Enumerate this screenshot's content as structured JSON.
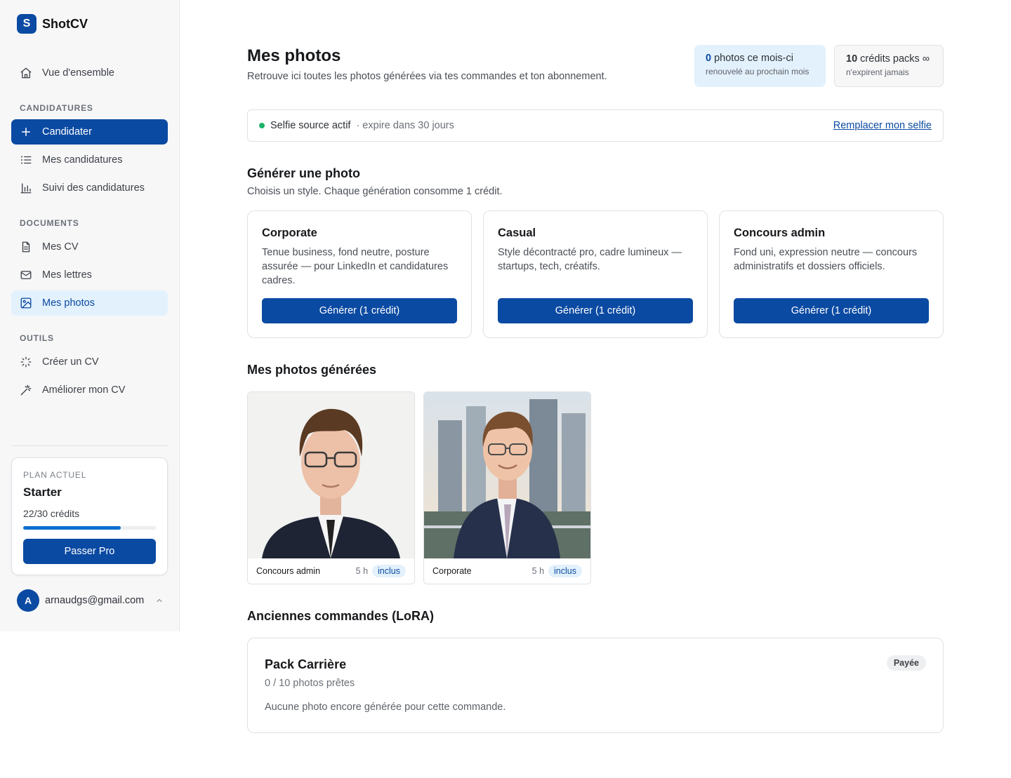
{
  "brand": {
    "logo_letter": "S",
    "name": "ShotCV"
  },
  "sidebar": {
    "overview": "Vue d'ensemble",
    "sections": {
      "candidatures": "CANDIDATURES",
      "documents": "DOCUMENTS",
      "outils": "OUTILS"
    },
    "items": {
      "candidater": "Candidater",
      "mes_candidatures": "Mes candidatures",
      "suivi": "Suivi des candidatures",
      "mes_cv": "Mes CV",
      "mes_lettres": "Mes lettres",
      "mes_photos": "Mes photos",
      "creer_cv": "Créer un CV",
      "ameliorer_cv": "Améliorer mon CV"
    },
    "plan": {
      "label": "PLAN ACTUEL",
      "name": "Starter",
      "credits_text": "22/30 crédits",
      "credits_used_fraction": 0.733,
      "upgrade_button": "Passer Pro"
    },
    "user": {
      "avatar_letter": "A",
      "email": "arnaudgs@gmail.com"
    }
  },
  "header": {
    "title": "Mes photos",
    "subtitle": "Retrouve ici toutes les photos générées via tes commandes et ton abonnement.",
    "monthly": {
      "count": "0",
      "label": "photos ce mois-ci",
      "note": "renouvelé au prochain mois"
    },
    "packs": {
      "count": "10",
      "label": "crédits packs ∞",
      "note": "n'expirent jamais"
    }
  },
  "selfie": {
    "status": "Selfie source actif",
    "expiry": "· expire dans 30 jours",
    "replace_link": "Remplacer mon selfie"
  },
  "generate": {
    "title": "Générer une photo",
    "description": "Choisis un style. Chaque génération consomme 1 crédit.",
    "styles": [
      {
        "name": "Corporate",
        "description": "Tenue business, fond neutre, posture assurée — pour LinkedIn et candidatures cadres.",
        "button": "Générer (1 crédit)"
      },
      {
        "name": "Casual",
        "description": "Style décontracté pro, cadre lumineux — startups, tech, créatifs.",
        "button": "Générer (1 crédit)"
      },
      {
        "name": "Concours admin",
        "description": "Fond uni, expression neutre — concours administratifs et dossiers officiels.",
        "button": "Générer (1 crédit)"
      }
    ]
  },
  "generated": {
    "title": "Mes photos générées",
    "photos": [
      {
        "style": "Concours admin",
        "age": "5 h",
        "badge": "inclus"
      },
      {
        "style": "Corporate",
        "age": "5 h",
        "badge": "inclus"
      }
    ]
  },
  "orders": {
    "title": "Anciennes commandes (LoRA)",
    "items": [
      {
        "name": "Pack Carrière",
        "progress": "0 / 10 photos prêtes",
        "empty": "Aucune photo encore générée pour cette commande.",
        "status": "Payée"
      }
    ]
  },
  "colors": {
    "accent": "#0b4aa2",
    "accent_light": "#e3f1fc",
    "status_green": "#1db36b"
  }
}
